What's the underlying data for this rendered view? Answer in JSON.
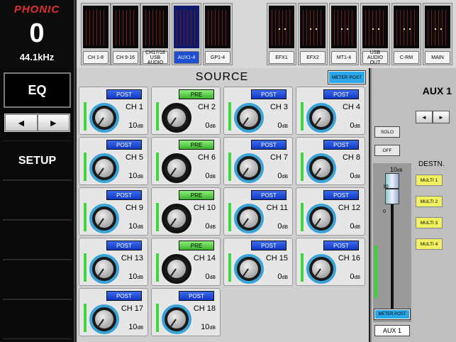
{
  "header": {
    "brand": "PHONIC",
    "value": "0",
    "sample_rate": "44.1kHz"
  },
  "banks": [
    {
      "label": "CH 1-8",
      "selected": false
    },
    {
      "label": "CH 9-16",
      "selected": false
    },
    {
      "label": "CH17/18\nUSB AUDIO",
      "selected": false
    },
    {
      "label": "AUX1-4",
      "selected": true
    },
    {
      "label": "GP1-4",
      "selected": false
    },
    {
      "label": "EFX1",
      "selected": false
    },
    {
      "label": "EFX2",
      "selected": false
    },
    {
      "label": "MT1-4",
      "selected": false
    },
    {
      "label": "USB AUDIO\nOUT",
      "selected": false
    },
    {
      "label": "C-RM",
      "selected": false
    },
    {
      "label": "MAIN",
      "selected": false
    }
  ],
  "left": {
    "eq_label": "EQ",
    "prev_arrow": "◄",
    "next_arrow": "►",
    "setup_label": "SETUP"
  },
  "source": {
    "title": "SOURCE",
    "meter_label": "METER POST",
    "channels": [
      {
        "name": "CH 1",
        "mode": "POST",
        "value": "10",
        "unit": "dB"
      },
      {
        "name": "CH 2",
        "mode": "PRE",
        "value": "0",
        "unit": "dB"
      },
      {
        "name": "CH 3",
        "mode": "POST",
        "value": "0",
        "unit": "dB"
      },
      {
        "name": "CH 4",
        "mode": "POST",
        "value": "0",
        "unit": "dB"
      },
      {
        "name": "CH 5",
        "mode": "POST",
        "value": "10",
        "unit": "dB"
      },
      {
        "name": "CH 6",
        "mode": "PRE",
        "value": "0",
        "unit": "dB"
      },
      {
        "name": "CH 7",
        "mode": "POST",
        "value": "0",
        "unit": "dB"
      },
      {
        "name": "CH 8",
        "mode": "POST",
        "value": "0",
        "unit": "dB"
      },
      {
        "name": "CH 9",
        "mode": "POST",
        "value": "10",
        "unit": "dB"
      },
      {
        "name": "CH 10",
        "mode": "PRE",
        "value": "0",
        "unit": "dB"
      },
      {
        "name": "CH 11",
        "mode": "POST",
        "value": "0",
        "unit": "dB"
      },
      {
        "name": "CH 12",
        "mode": "POST",
        "value": "0",
        "unit": "dB"
      },
      {
        "name": "CH 13",
        "mode": "POST",
        "value": "10",
        "unit": "dB"
      },
      {
        "name": "CH 14",
        "mode": "PRE",
        "value": "0",
        "unit": "dB"
      },
      {
        "name": "CH 15",
        "mode": "POST",
        "value": "0",
        "unit": "dB"
      },
      {
        "name": "CH 16",
        "mode": "POST",
        "value": "0",
        "unit": "dB"
      },
      {
        "name": "CH 17",
        "mode": "POST",
        "value": "10",
        "unit": "dB"
      },
      {
        "name": "CH 18",
        "mode": "POST",
        "value": "10",
        "unit": "dB"
      }
    ]
  },
  "aux": {
    "title": "AUX 1",
    "prev_arrow": "◄",
    "next_arrow": "►",
    "solo_label": "SOLO",
    "off_label": "OFF",
    "destn_label": "DESTN.",
    "destinations": [
      "MULTI 1",
      "MULTI 2",
      "MULTI 3",
      "MULTI 4"
    ],
    "fader_value": "10",
    "fader_unit": "dB",
    "fader_ticks": [
      "10",
      "0"
    ],
    "meter_label": "METER POST",
    "name": "AUX 1"
  },
  "colors": {
    "post": "#1e4fd0",
    "pre": "#3ab22a",
    "meter": "#3fd63f",
    "brand": "#e23030"
  }
}
